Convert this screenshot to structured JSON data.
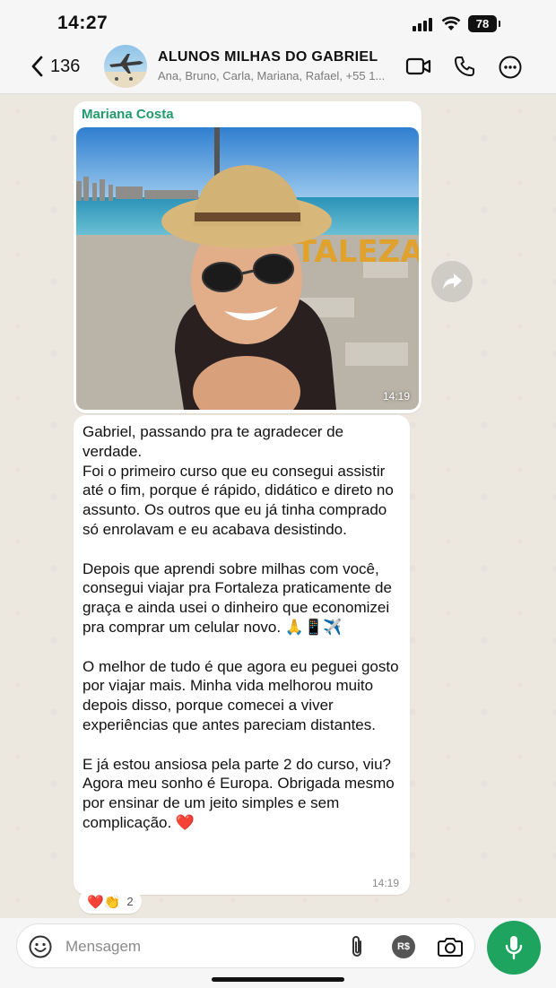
{
  "status_bar": {
    "time": "14:27",
    "battery": "78"
  },
  "header": {
    "back_count": "136",
    "group_name": "ALUNOS MILHAS DO GABRIEL",
    "members": "Ana, Bruno, Carla, Mariana, Rafael, +55 1..."
  },
  "messages": {
    "image_msg": {
      "sender": "Mariana Costa",
      "time": "14:19",
      "photo_sign": "FORTALEZA"
    },
    "text_msg": {
      "text": "Gabriel, passando pra te agradecer de verdade.\nFoi o primeiro curso que eu consegui assistir até o fim, porque é rápido, didático e direto no assunto. Os outros que eu já tinha comprado só enrolavam e eu acabava desistindo.\n\nDepois que aprendi sobre milhas com você, consegui viajar pra Fortaleza praticamente de graça e ainda usei o dinheiro que economizei pra comprar um celular novo. 🙏📱✈️\n\nO melhor de tudo é que agora eu peguei gosto por viajar mais. Minha vida melhorou muito depois disso, porque comecei a viver experiências que antes pareciam distantes.\n\nE já estou ansiosa pela parte 2 do curso, viu? Agora meu sonho é Europa. Obrigada mesmo por ensinar de um jeito simples e sem complicação. ❤️",
      "time": "14:19"
    },
    "reactions": {
      "emojis": "❤️👏",
      "count": "2"
    }
  },
  "composer": {
    "placeholder": "Mensagem",
    "currency_label": "R$"
  },
  "colors": {
    "accent_green": "#1fa45f",
    "sender_green": "#1f9b6c"
  },
  "icons": [
    "back-chevron-icon",
    "video-call-icon",
    "phone-icon",
    "more-icon",
    "forward-icon",
    "sticker-icon",
    "attach-icon",
    "payment-icon",
    "camera-icon",
    "mic-icon"
  ]
}
